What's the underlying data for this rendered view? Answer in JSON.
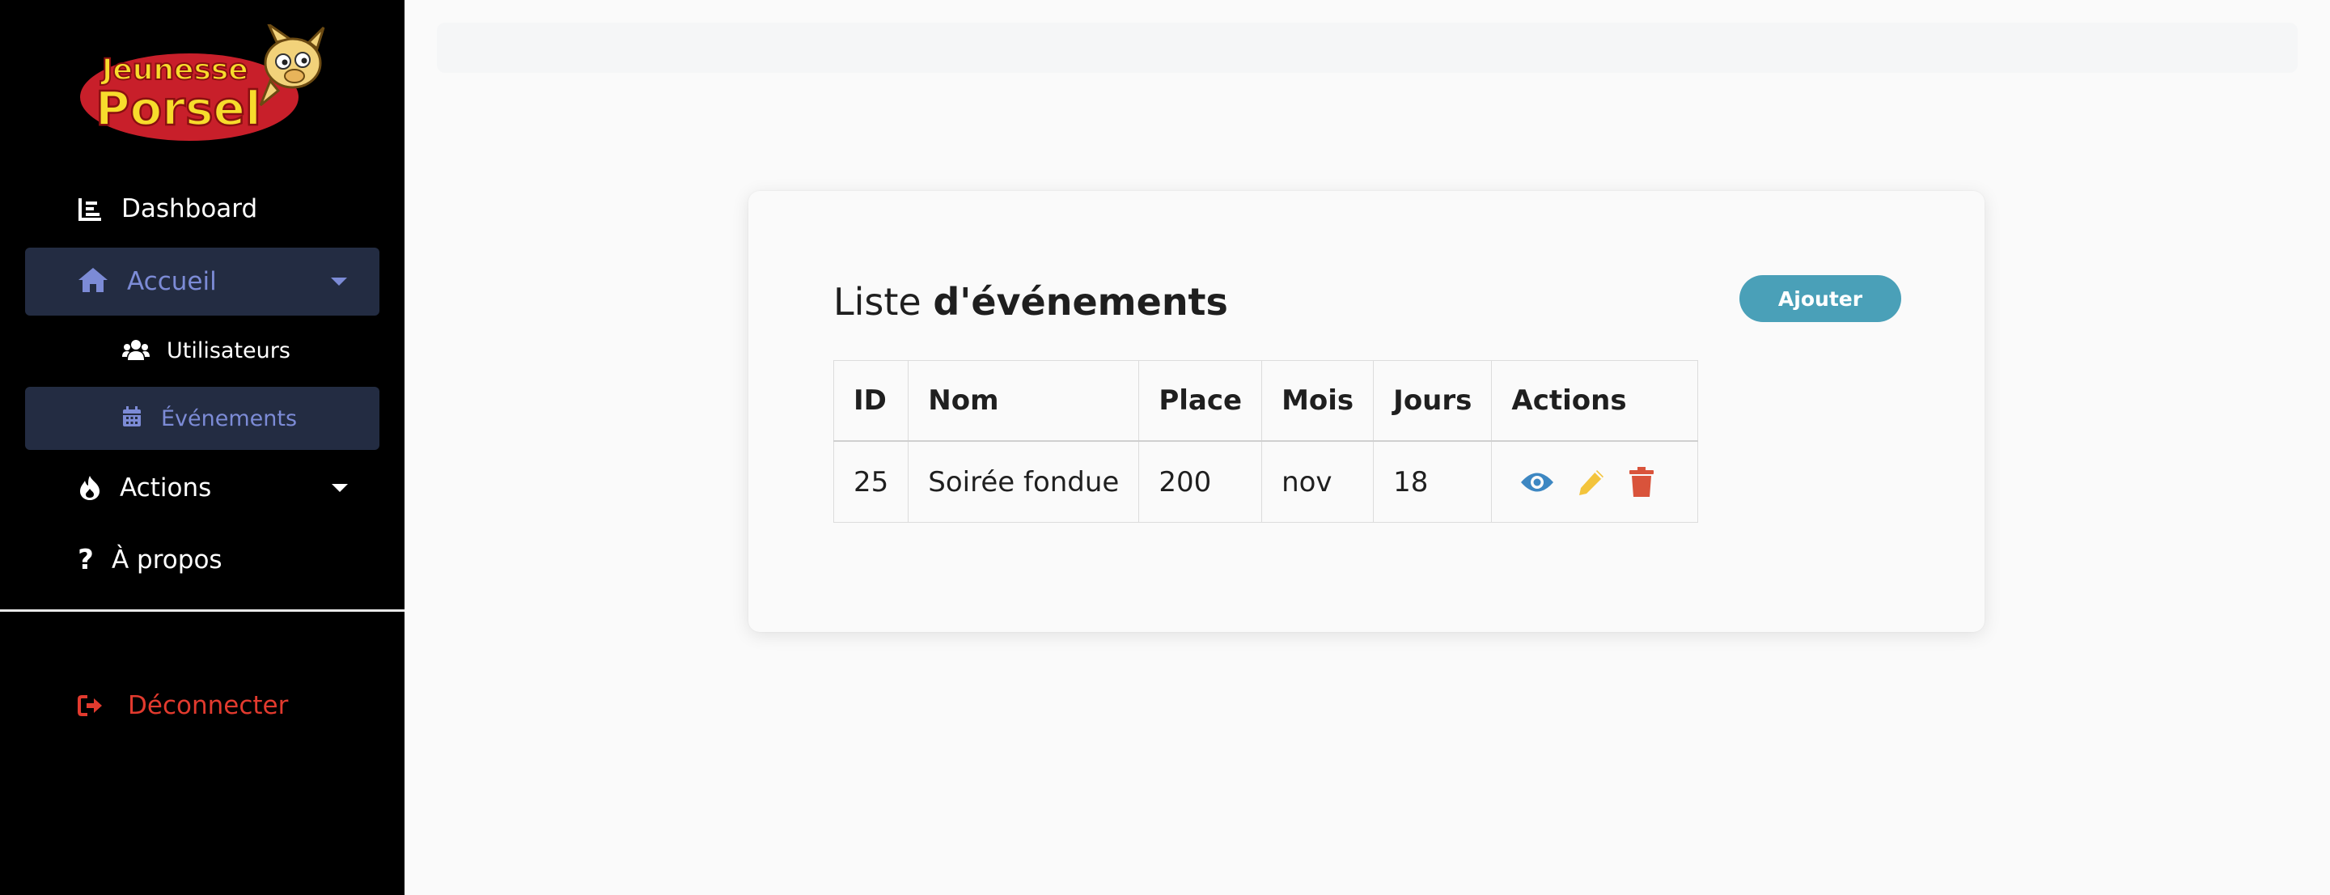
{
  "sidebar": {
    "logo": {
      "line1": "Jeunesse",
      "line2": "Porsel"
    },
    "items": {
      "dashboard": {
        "label": "Dashboard",
        "icon": "chart-bar-icon"
      },
      "accueil": {
        "label": "Accueil",
        "icon": "home-icon"
      },
      "utilisateurs": {
        "label": "Utilisateurs",
        "icon": "users-icon"
      },
      "evenements": {
        "label": "Événements",
        "icon": "calendar-icon"
      },
      "actions": {
        "label": "Actions",
        "icon": "fire-icon"
      },
      "apropos": {
        "label": "À propos",
        "icon": "question-icon"
      },
      "logout": {
        "label": "Déconnecter",
        "icon": "sign-out-icon"
      }
    }
  },
  "main": {
    "title_prefix": "Liste",
    "title_bold": "d'événements",
    "add_label": "Ajouter",
    "table": {
      "headers": [
        "ID",
        "Nom",
        "Place",
        "Mois",
        "Jours",
        "Actions"
      ],
      "rows": [
        {
          "id": "25",
          "nom": "Soirée fondue",
          "place": "200",
          "mois": "nov",
          "jours": "18"
        }
      ]
    }
  },
  "colors": {
    "accent": "#7c8bd6",
    "active_bg": "#232c42",
    "add_button": "#4aa0b8",
    "view_icon": "#3d87c2",
    "edit_icon": "#f3c43c",
    "delete_icon": "#d9533b",
    "logout": "#e23a2e"
  }
}
